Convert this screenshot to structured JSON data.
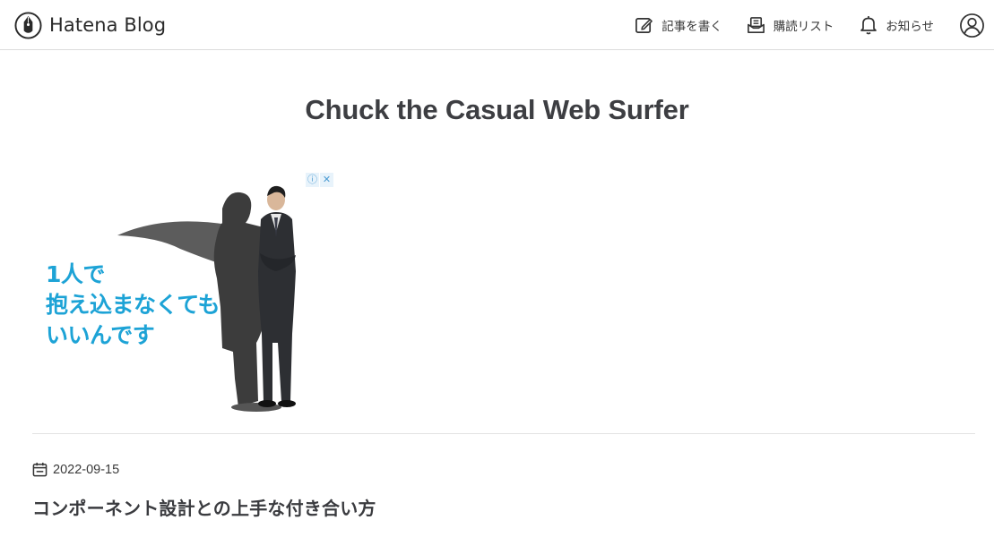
{
  "header": {
    "brand_name": "Hatena Blog",
    "nav": {
      "write_label": "記事を書く",
      "subscribe_label": "購読リスト",
      "notifications_label": "お知らせ"
    },
    "icons": {
      "brand": "hatena-pen-icon",
      "write": "edit-icon",
      "subscribe": "reading-list-icon",
      "notifications": "bell-icon",
      "account": "user-icon"
    }
  },
  "blog": {
    "title": "Chuck the Casual Web Surfer"
  },
  "ad": {
    "copy_line1": "1人で",
    "copy_line2": "抱え込まなくても",
    "copy_line3": "いいんです",
    "badge_info": "ⓘ",
    "badge_close": "✕",
    "accent_color": "#1da3d6"
  },
  "entry": {
    "date": "2022-09-15",
    "title": "コンポーネント設計との上手な付き合い方"
  }
}
